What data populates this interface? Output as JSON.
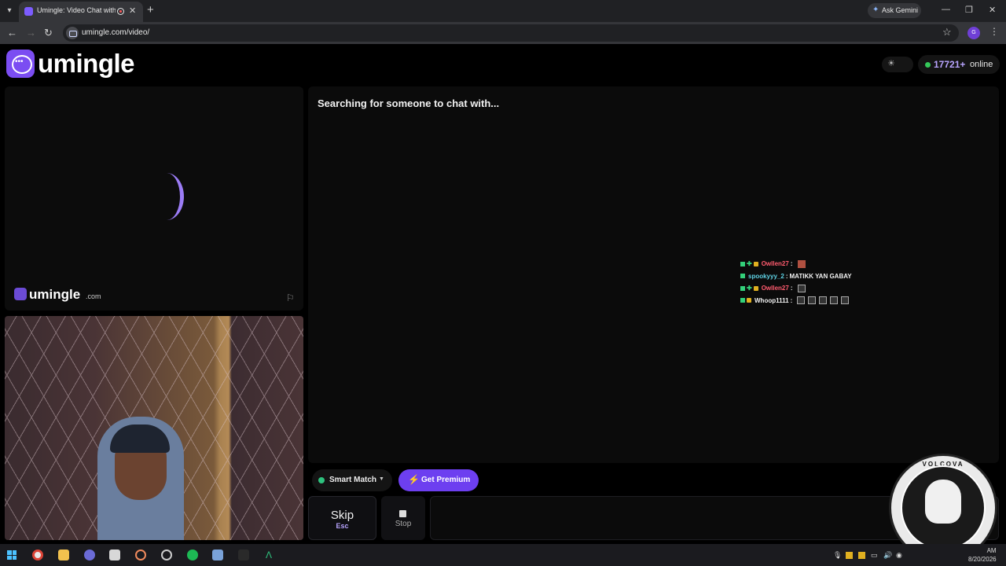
{
  "browser": {
    "tab_title": "Umingle: Video Chat with S",
    "ask_gemini": "Ask Gemini",
    "url": "umingle.com/video/",
    "profile_initial": "G"
  },
  "header": {
    "logo_text": "umingle",
    "online_count": "17721+",
    "online_label": "online"
  },
  "remote_video": {
    "watermark": "umingle",
    "watermark_tld": ".com"
  },
  "main": {
    "status": "Searching for someone to chat with..."
  },
  "overlay_chat": [
    {
      "user": "Owllen27",
      "sep": ":",
      "message": "",
      "emotes": 1,
      "user_color": "#ff5b6e"
    },
    {
      "user": "spookyyy_2",
      "sep": ":",
      "message": "MATIKK YAN GABAY",
      "emotes": 0,
      "user_color": "#5fd3e6"
    },
    {
      "user": "Owllen27",
      "sep": ":",
      "message": "",
      "emotes": 1,
      "user_color": "#ff5b6e"
    },
    {
      "user": "Whoop1111",
      "sep": ":",
      "message": "",
      "emotes": 5,
      "user_color": "#f2f2f2"
    }
  ],
  "controls": {
    "smart_match": "Smart Match",
    "premium": "Get Premium",
    "skip_label": "Skip",
    "skip_key": "Esc",
    "stop_label": "Stop"
  },
  "seal": {
    "text": "VOLCOVA"
  },
  "taskbar": {
    "date": "8/20/2026",
    "time": "AM"
  },
  "colors": {
    "brand": "#7b4df2",
    "online_dot": "#34c759",
    "accent_text": "#b8a4ff"
  }
}
